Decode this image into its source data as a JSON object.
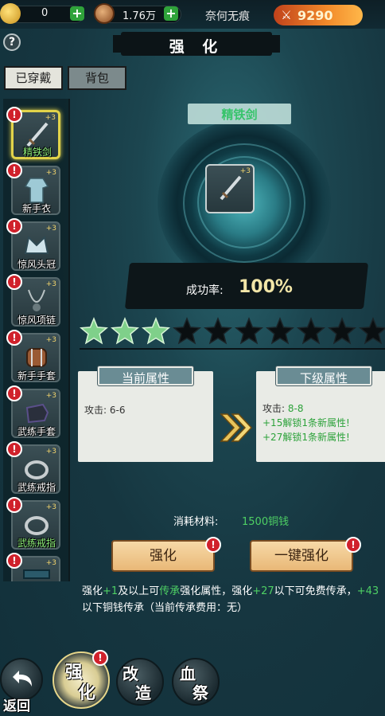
{
  "top_bar": {
    "gold_value": "0",
    "coins_value": "1.76万",
    "player_name": "奈何无痕",
    "combat_power": "9290",
    "icons": [
      "gold-ingot-icon",
      "copper-coin-icon",
      "plus-icon",
      "crossed-swords-icon"
    ]
  },
  "page": {
    "title": "强 化",
    "help_symbol": "?"
  },
  "tabs": [
    {
      "label": "已穿戴",
      "active": true
    },
    {
      "label": "背包",
      "active": false
    }
  ],
  "equipment": [
    {
      "name": "精铁剑",
      "level": "+3",
      "selected": true,
      "icon": "sword-icon",
      "label_color": "#8ef07a"
    },
    {
      "name": "新手衣",
      "level": "+3",
      "selected": false,
      "icon": "robe-icon",
      "label_color": "#ffffff"
    },
    {
      "name": "惊风头冠",
      "level": "+3",
      "selected": false,
      "icon": "crown-icon",
      "label_color": "#ffffff"
    },
    {
      "name": "惊风项链",
      "level": "+3",
      "selected": false,
      "icon": "necklace-icon",
      "label_color": "#ffffff"
    },
    {
      "name": "新手手套",
      "level": "+3",
      "selected": false,
      "icon": "bracer-icon",
      "label_color": "#ffffff"
    },
    {
      "name": "武练手套",
      "level": "+3",
      "selected": false,
      "icon": "glove-icon",
      "label_color": "#ffffff"
    },
    {
      "name": "武练戒指",
      "level": "+3",
      "selected": false,
      "icon": "ring-icon",
      "label_color": "#ffffff"
    },
    {
      "name": "武练戒指",
      "level": "+3",
      "selected": false,
      "icon": "ring-icon",
      "label_color": "#8ef07a"
    },
    {
      "name": "",
      "level": "+3",
      "selected": false,
      "icon": "belt-icon",
      "label_color": "#ffffff"
    }
  ],
  "item": {
    "name": "精铁剑",
    "level": "+3",
    "success_label": "成功率:",
    "success_value": "100%"
  },
  "stars": {
    "filled": 3,
    "total": 10
  },
  "current_attrs": {
    "title": "当前属性",
    "lines": [
      "攻击: 6-6"
    ]
  },
  "next_attrs": {
    "title": "下级属性",
    "attack_prefix": "攻击:",
    "attack_value": "8-8",
    "unlocks": [
      "+15解锁1条新属性!",
      "+27解锁1条新属性!"
    ]
  },
  "cost": {
    "label": "消耗材料:",
    "value": "1500铜钱"
  },
  "buttons": {
    "enhance": "强化",
    "one_click": "一键强化"
  },
  "description": {
    "p1": "强化",
    "p2": "+1",
    "p3": "及以上可",
    "p4": "传承",
    "p5": "强化属性，强化",
    "p6": "+27",
    "p7": "以下可免费传承，",
    "p8": "+43",
    "p9": "以下铜钱传承（当前传承费用：无）"
  },
  "bottom_nav": {
    "back_label": "返回",
    "tabs": [
      {
        "label1": "强",
        "label2": "化",
        "active": true
      },
      {
        "label1": "改",
        "label2": "造",
        "active": false
      },
      {
        "label1": "血",
        "label2": "祭",
        "active": false
      }
    ]
  },
  "alert_symbol": "!",
  "colors": {
    "accent_green": "#4ed064",
    "power_orange": "#f28a2a",
    "alert_red": "#d0212b",
    "button_tan": "#e9b877"
  }
}
